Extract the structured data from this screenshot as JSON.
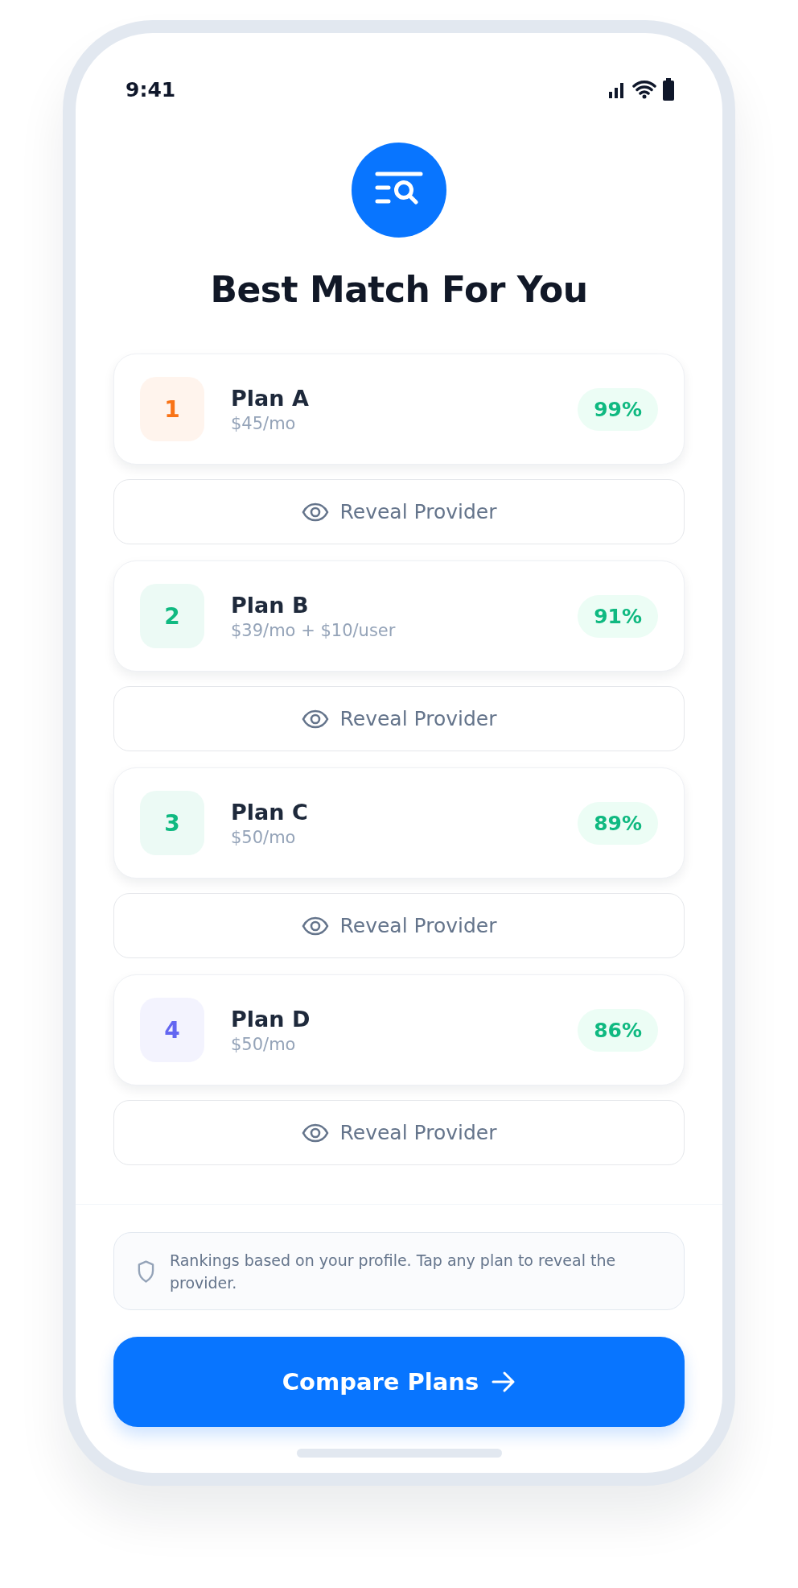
{
  "status_bar": {
    "time": "9:41"
  },
  "title": "Best Match For You",
  "plans": [
    {
      "rank": "1",
      "color": "#f97316",
      "name": "Plan A",
      "price": "$45/mo",
      "match": "99%",
      "action": "Reveal Provider"
    },
    {
      "rank": "2",
      "color": "#10b981",
      "name": "Plan B",
      "price": "$39/mo + $10/user",
      "match": "91%",
      "action": "Reveal Provider"
    },
    {
      "rank": "3",
      "color": "#10b981",
      "name": "Plan C",
      "price": "$50/mo",
      "match": "89%",
      "action": "Reveal Provider"
    },
    {
      "rank": "4",
      "color": "#6366f1",
      "name": "Plan D",
      "price": "$50/mo",
      "match": "86%",
      "action": "Reveal Provider"
    }
  ],
  "note": "Rankings based on your profile. Tap any plan to reveal the provider.",
  "primary_button": "Compare Plans"
}
